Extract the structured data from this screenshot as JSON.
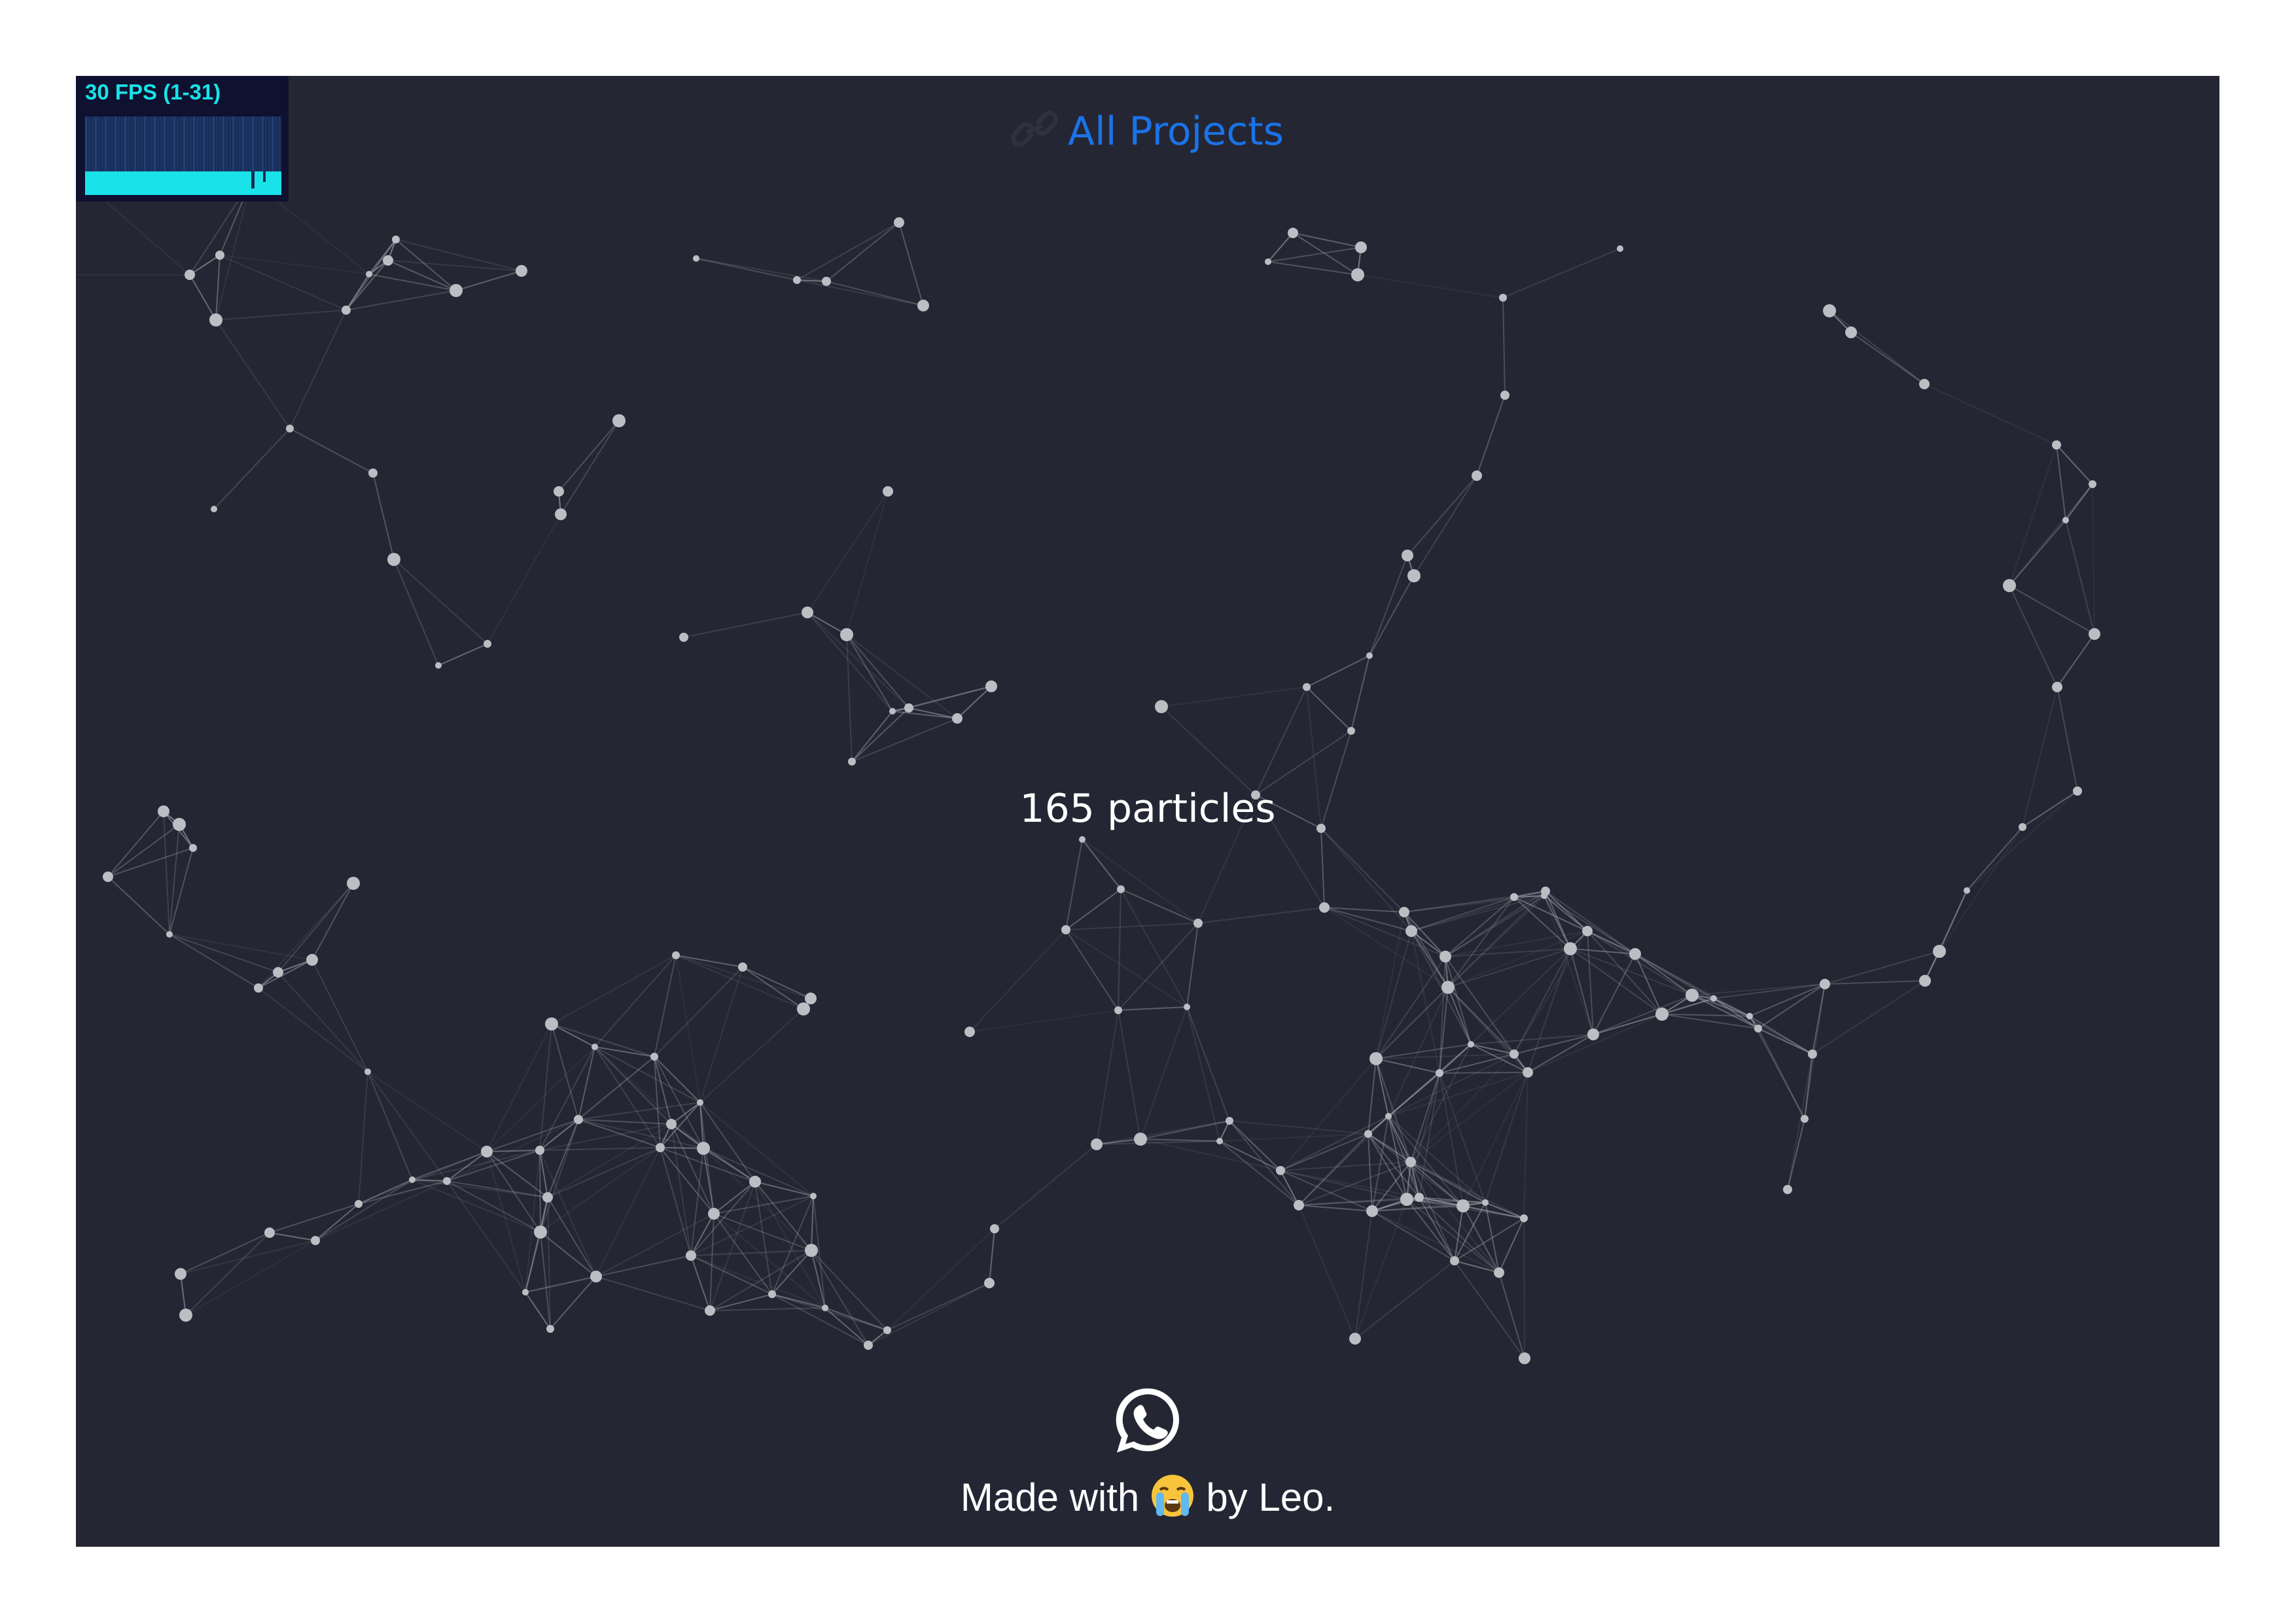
{
  "fps_meter": {
    "label": "30 FPS (1-31)",
    "text_color": "#19e3e8",
    "background": "#0e1230",
    "graph_background": "#182d55",
    "bar_color": "#19e3e8"
  },
  "header": {
    "link_label": "All Projects",
    "link_icon": "link-icon",
    "link_color": "#1a73e8"
  },
  "stats": {
    "particle_count_text": "165 particles"
  },
  "footer": {
    "whatsapp_icon": "whatsapp-icon",
    "credit_prefix": "Made with",
    "credit_emoji": "crying-face-emoji",
    "credit_suffix": "by Leo."
  },
  "theme": {
    "page_background": "#ffffff",
    "canvas_background": "#252633",
    "particle_color": "#bdbdc4",
    "line_color": "#a8a8b4"
  }
}
